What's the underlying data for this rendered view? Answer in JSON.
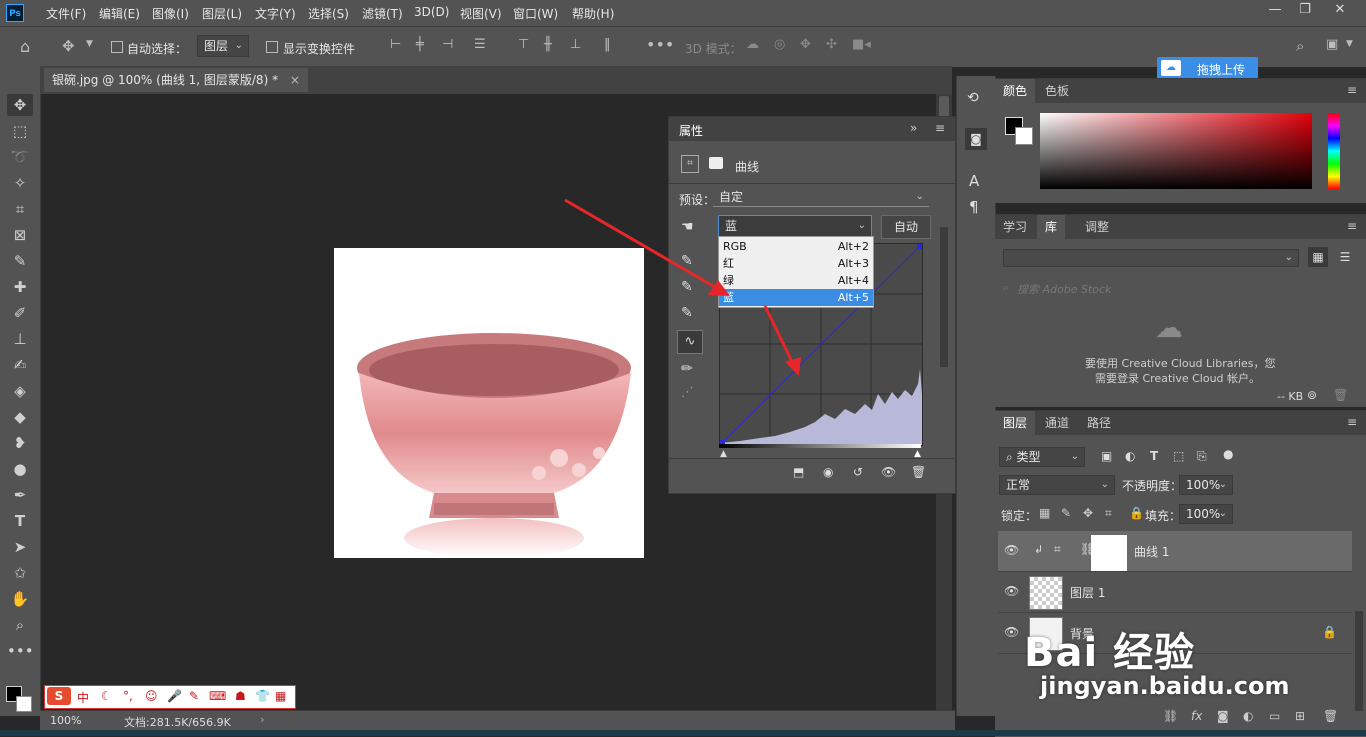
{
  "app": {
    "logo": "Ps"
  },
  "menu": [
    "文件(F)",
    "编辑(E)",
    "图像(I)",
    "图层(L)",
    "文字(Y)",
    "选择(S)",
    "滤镜(T)",
    "3D(D)",
    "视图(V)",
    "窗口(W)",
    "帮助(H)"
  ],
  "options": {
    "auto_select_label": "自动选择：",
    "auto_select_value": "图层",
    "show_transform_label": "显示变换控件",
    "mode_3d_label": "3D 模式：",
    "upload_label": "拖拽上传"
  },
  "document": {
    "tab_title": "银碗.jpg @ 100% (曲线 1, 图层蒙版/8) *",
    "tab_close": "×"
  },
  "properties": {
    "tab_label": "属性",
    "adjustment_title": "曲线",
    "preset_label": "预设：",
    "preset_value": "自定",
    "channel_value": "蓝",
    "auto_button": "自动",
    "channel_options": [
      {
        "label": "RGB",
        "shortcut": "Alt+2"
      },
      {
        "label": "红",
        "shortcut": "Alt+3"
      },
      {
        "label": "绿",
        "shortcut": "Alt+4"
      },
      {
        "label": "蓝",
        "shortcut": "Alt+5"
      }
    ],
    "selected_channel_index": 3
  },
  "color_panel": {
    "tabs": [
      "颜色",
      "色板"
    ]
  },
  "library_panel": {
    "tabs": [
      "学习",
      "库",
      "调整"
    ],
    "search_placeholder": "搜索 Adobe Stock",
    "message_line1": "要使用 Creative Cloud Libraries，您",
    "message_line2": "需要登录 Creative Cloud 帐户。",
    "size_label": "-- KB"
  },
  "layers_panel": {
    "tabs": [
      "图层",
      "通道",
      "路径"
    ],
    "filter_value": "类型",
    "blend_mode": "正常",
    "opacity_label": "不透明度：",
    "opacity_value": "100%",
    "lock_label": "锁定：",
    "fill_label": "填充：",
    "fill_value": "100%",
    "layers": [
      {
        "name": "曲线 1",
        "selected": true
      },
      {
        "name": "图层 1",
        "selected": false
      },
      {
        "name": "背景",
        "selected": false
      }
    ]
  },
  "status": {
    "zoom": "100%",
    "doc_size": "文档:281.5K/656.9K"
  },
  "watermark": {
    "brand": "Bai 经验",
    "url": "jingyan.baidu.com"
  },
  "ime": {
    "zh": "中"
  }
}
